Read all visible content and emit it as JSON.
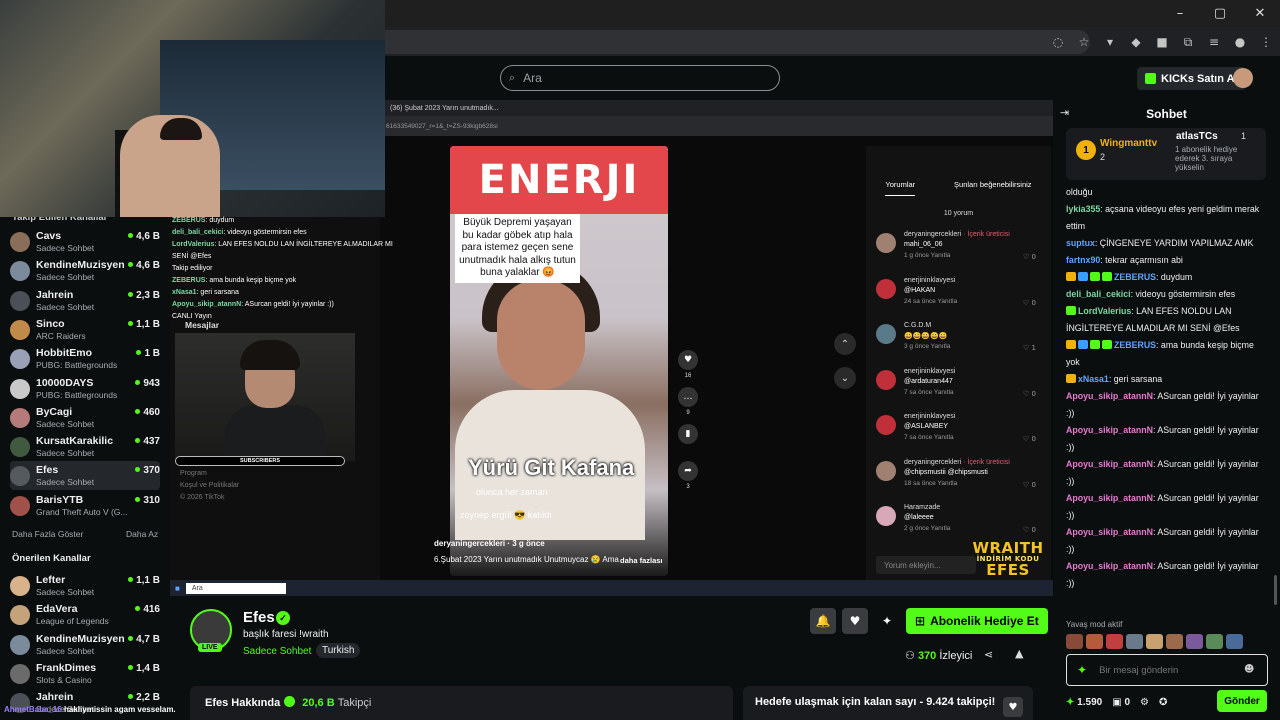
{
  "search": {
    "placeholder": "Ara"
  },
  "topbar": {
    "buy_kicks": "KICKs Satın Al"
  },
  "sidebar": {
    "followed_header": "Takip Edilen Kanallar",
    "channels": [
      {
        "name": "Cavs",
        "category": "Sadece Sohbet",
        "viewers": "4,6 B",
        "color": "#8a6e5a"
      },
      {
        "name": "KendineMuzisyen",
        "category": "Sadece Sohbet",
        "viewers": "4,6 B",
        "color": "#7c8b9c"
      },
      {
        "name": "Jahrein",
        "category": "Sadece Sohbet",
        "viewers": "2,3 B",
        "color": "#4b4f57"
      },
      {
        "name": "Sinco",
        "category": "ARC Raiders",
        "viewers": "1,1 B",
        "color": "#c08a4a"
      },
      {
        "name": "HobbitEmo",
        "category": "PUBG: Battlegrounds",
        "viewers": "1 B",
        "color": "#9aa0b5"
      },
      {
        "name": "10000DAYS",
        "category": "PUBG: Battlegrounds",
        "viewers": "943",
        "color": "#c9c9c9"
      },
      {
        "name": "ByCagi",
        "category": "Sadece Sohbet",
        "viewers": "460",
        "color": "#b57a7a"
      },
      {
        "name": "KursatKarakilic",
        "category": "Sadece Sohbet",
        "viewers": "437",
        "color": "#3f5a3f"
      },
      {
        "name": "Efes",
        "category": "Sadece Sohbet",
        "viewers": "370",
        "color": "#555a5e"
      },
      {
        "name": "BarisYTB",
        "category": "Grand Theft Auto V (G...",
        "viewers": "310",
        "color": "#a0524a"
      }
    ],
    "show_more": "Daha Fazla Göster",
    "show_less": "Daha Az",
    "recommended_header": "Önerilen Kanallar",
    "recommended": [
      {
        "name": "Lefter",
        "category": "Sadece Sohbet",
        "viewers": "1,1 B",
        "color": "#d8b28a"
      },
      {
        "name": "EdaVera",
        "category": "League of Legends",
        "viewers": "416",
        "color": "#c4a37a"
      },
      {
        "name": "KendineMuzisyen",
        "category": "Sadece Sohbet",
        "viewers": "4,7 B",
        "color": "#7c8b9c"
      },
      {
        "name": "FrankDimes",
        "category": "Slots & Casino",
        "viewers": "1,4 B",
        "color": "#6b6b6b"
      },
      {
        "name": "Jahrein",
        "category": "Sadece Sohbet",
        "viewers": "2,2 B",
        "color": "#4b4f57"
      }
    ]
  },
  "inner_browser": {
    "tab_title": "(36) Şubat 2023 Yarın unutmadık...",
    "url": "61633549027_r=1&_t=ZS-93kigb628si"
  },
  "tiktok": {
    "energy": "ENERJI",
    "caption": "Büyük Depremi yaşayan bu kadar göbek atıp hala para istemez geçen sene unutmadık hala alkış tutun buna yalaklar 😡",
    "big_text": "Yürü Git Kafana",
    "sub_text": "olunca her zaman",
    "joined": "zeynep ergül 😎 katıldı",
    "author": "deryaningercekleri · 3 g önce",
    "desc": "6.Şubat 2023 Yarın unutmadık Unutmuycaz 😢 Ama",
    "more": "daha fazlası",
    "likes": "16",
    "comments_n": "9",
    "shares": "3",
    "tab_comments": "Yorumlar",
    "tab_like": "Şunları beğenebilirsiniz",
    "comment_count": "10 yorum",
    "comments": [
      {
        "user": "deryaningercekleri",
        "tag": "· İçerik üreticisi",
        "text": "mahi_06_06",
        "meta": "1 g önce    Yanıtla",
        "likes": "♡ 0",
        "color": "#a08070"
      },
      {
        "user": "enerjininklavyesi",
        "tag": "",
        "text": "@HAKAN",
        "meta": "24 sa önce    Yanıtla",
        "likes": "♡ 0",
        "color": "#c0303a"
      },
      {
        "user": "C.G.D.M",
        "tag": "",
        "text": "😀😀😀😀😀",
        "meta": "3 g önce    Yanıtla",
        "likes": "♡ 1",
        "color": "#5a7a8a"
      },
      {
        "user": "enerjininklavyesi",
        "tag": "",
        "text": "@ardaturan447",
        "meta": "7 sa önce    Yanıtla",
        "likes": "♡ 0",
        "color": "#c0303a"
      },
      {
        "user": "enerjininklavyesi",
        "tag": "",
        "text": "@ASLANBEY",
        "meta": "7 sa önce    Yanıtla",
        "likes": "♡ 0",
        "color": "#c0303a"
      },
      {
        "user": "deryaningercekleri",
        "tag": "· İçerik üreticisi",
        "text": "@chipsmustii @chipsmusti",
        "meta": "18 sa önce    Yanıtla",
        "likes": "♡ 0",
        "color": "#a08070"
      },
      {
        "user": "Haramzade",
        "tag": "",
        "text": "@laleeee",
        "meta": "2 g önce    Yanıtla",
        "likes": "♡ 0",
        "color": "#d8a8b8"
      }
    ],
    "comment_input": "Yorum ekleyin...",
    "wraith": "WRAITH",
    "wraith_sub": "İNDİRİM KODU",
    "wraith_code": "EFES"
  },
  "overlay_chat": {
    "lines": [
      {
        "u": "ZEBERUS",
        "t": ": duydum"
      },
      {
        "u": "deli_bali_cekici",
        "t": ": videoyu göstermirsin efes"
      },
      {
        "u": "LordValerius",
        "t": ": LAN EFES NOLDU LAN İNGİLTEREYE ALMADILAR MI SENİ @Efes"
      },
      {
        "u": "",
        "t": "Takip ediliyor"
      },
      {
        "u": "ZEBERUS",
        "t": ": ama bunda keşip biçme yok"
      },
      {
        "u": "xNasa1",
        "t": ": geri sarsana"
      },
      {
        "u": "Apoyu_sikip_atannN",
        "t": ": ASurcan geldi! İyi yayinlar :))"
      },
      {
        "u": "",
        "t": "CANLI Yayın"
      }
    ],
    "messages_label": "Mesajlar",
    "subscribers": "SUBSCRIBERS",
    "program": "Program",
    "politics": "Koşul ve Politikalar",
    "copyright": "© 2026 TikTok"
  },
  "taskbar": {
    "search": "Ara"
  },
  "stream": {
    "name": "Efes",
    "live": "LIVE",
    "title": "başlık faresi !wraith",
    "category": "Sadece Sohbet",
    "tag": "Turkish",
    "sub_gift": "Abonelik Hediye Et",
    "viewers_n": "370",
    "viewers_label": "İzleyici",
    "about": "Efes Hakkında",
    "followers_n": "20,6 B",
    "followers_label": "Takipçi",
    "goal": "Hedefe ulaşmak için kalan sayı - 9.424 takipçi!"
  },
  "chat": {
    "title": "Sohbet",
    "pinned_user": "Wingmanttv",
    "pinned_rank": "1",
    "pinned_n": "2",
    "atlas": "atlasTCs",
    "atlas_n": "1",
    "atlas_sub": "1 abonelik hediye ederek 3. sıraya yükselin",
    "messages": [
      {
        "n": "",
        "c": "#efeff1",
        "t": "olduğu",
        "badges": []
      },
      {
        "n": "lykia355",
        "c": "#7cd8a2",
        "t": ": açsana videoyu efes yeni geldim merak ettim",
        "badges": []
      },
      {
        "n": "suptux",
        "c": "#5ea6ff",
        "t": ": ÇİNGENEYE YARDIM YAPILMAZ AMK",
        "badges": []
      },
      {
        "n": "fartnx90",
        "c": "#5ea6ff",
        "t": ": tekrar açarmısın abi",
        "badges": []
      },
      {
        "n": "ZEBERUS",
        "c": "#5ea6ff",
        "t": ": duydum",
        "badges": [
          "#f0b10e",
          "#3aa0ff",
          "#53fc18",
          "#53fc18"
        ]
      },
      {
        "n": "deli_bali_cekici",
        "c": "#7cd8a2",
        "t": ": videoyu göstermirsin efes",
        "badges": []
      },
      {
        "n": "LordValerius",
        "c": "#7cd8a2",
        "t": ": LAN EFES NOLDU LAN İNGİLTEREYE ALMADILAR MI SENİ @Efes",
        "badges": [
          "#53fc18"
        ]
      },
      {
        "n": "ZEBERUS",
        "c": "#5ea6ff",
        "t": ": ama bunda keşip biçme yok",
        "badges": [
          "#f0b10e",
          "#3aa0ff",
          "#53fc18",
          "#53fc18"
        ]
      },
      {
        "n": "xNasa1",
        "c": "#5ea6ff",
        "t": ": geri sarsana",
        "badges": [
          "#f0b10e"
        ]
      },
      {
        "n": "Apoyu_sikip_atannN",
        "c": "#e77bd0",
        "t": ": ASurcan geldi! İyi yayinlar :))",
        "badges": []
      },
      {
        "n": "Apoyu_sikip_atannN",
        "c": "#e77bd0",
        "t": ": ASurcan geldi! İyi yayinlar :))",
        "badges": []
      },
      {
        "n": "Apoyu_sikip_atannN",
        "c": "#e77bd0",
        "t": ": ASurcan geldi! İyi yayinlar :))",
        "badges": []
      },
      {
        "n": "Apoyu_sikip_atannN",
        "c": "#e77bd0",
        "t": ": ASurcan geldi! İyi yayinlar :))",
        "badges": []
      },
      {
        "n": "Apoyu_sikip_atannN",
        "c": "#e77bd0",
        "t": ": ASurcan geldi! İyi yayinlar :))",
        "badges": []
      },
      {
        "n": "Apoyu_sikip_atannN",
        "c": "#e77bd0",
        "t": ": ASurcan geldi! İyi yayinlar :))",
        "badges": []
      }
    ],
    "slow_mode": "Yavaş mod aktif",
    "input_placeholder": "Bir mesaj gönderin",
    "kicks": "1.590",
    "gifts": "0",
    "send": "Gönder"
  },
  "bottom_banner": {
    "user": "AhmetBaba_16",
    "text": " hakliymissin agam vesselam."
  },
  "colors": {
    "accent": "#53fc18",
    "bg": "#0b0e0f"
  }
}
